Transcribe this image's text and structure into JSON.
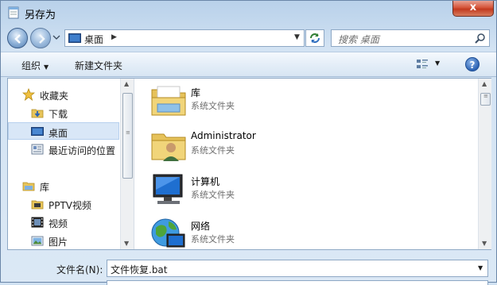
{
  "window": {
    "title": "另存为",
    "close_label": "x"
  },
  "nav": {
    "address_location": "桌面",
    "search_placeholder": "搜索 桌面"
  },
  "toolbar": {
    "organize_label": "组织",
    "new_folder_label": "新建文件夹",
    "help_label": "?"
  },
  "sidebar": {
    "items": [
      {
        "label": "收藏夹",
        "icon": "star-icon"
      },
      {
        "label": "下载",
        "icon": "download-folder-icon"
      },
      {
        "label": "桌面",
        "icon": "desktop-icon",
        "selected": true
      },
      {
        "label": "最近访问的位置",
        "icon": "recent-places-icon"
      },
      {
        "label": "库",
        "icon": "library-icon"
      },
      {
        "label": "PPTV视频",
        "icon": "video-folder-icon"
      },
      {
        "label": "视频",
        "icon": "video-icon"
      },
      {
        "label": "图片",
        "icon": "picture-icon"
      }
    ]
  },
  "files": [
    {
      "name": "库",
      "type": "系统文件夹",
      "icon": "library-folder-icon"
    },
    {
      "name": "Administrator",
      "type": "系统文件夹",
      "icon": "user-folder-icon"
    },
    {
      "name": "计算机",
      "type": "系统文件夹",
      "icon": "computer-icon"
    },
    {
      "name": "网络",
      "type": "系统文件夹",
      "icon": "network-icon"
    }
  ],
  "footer": {
    "filename_label": "文件名(N):",
    "filename_value": "文件恢复.bat"
  },
  "colors": {
    "selection": "#d9e7f7",
    "close_button": "#c23a1f",
    "frame": "#b9d1ea"
  }
}
